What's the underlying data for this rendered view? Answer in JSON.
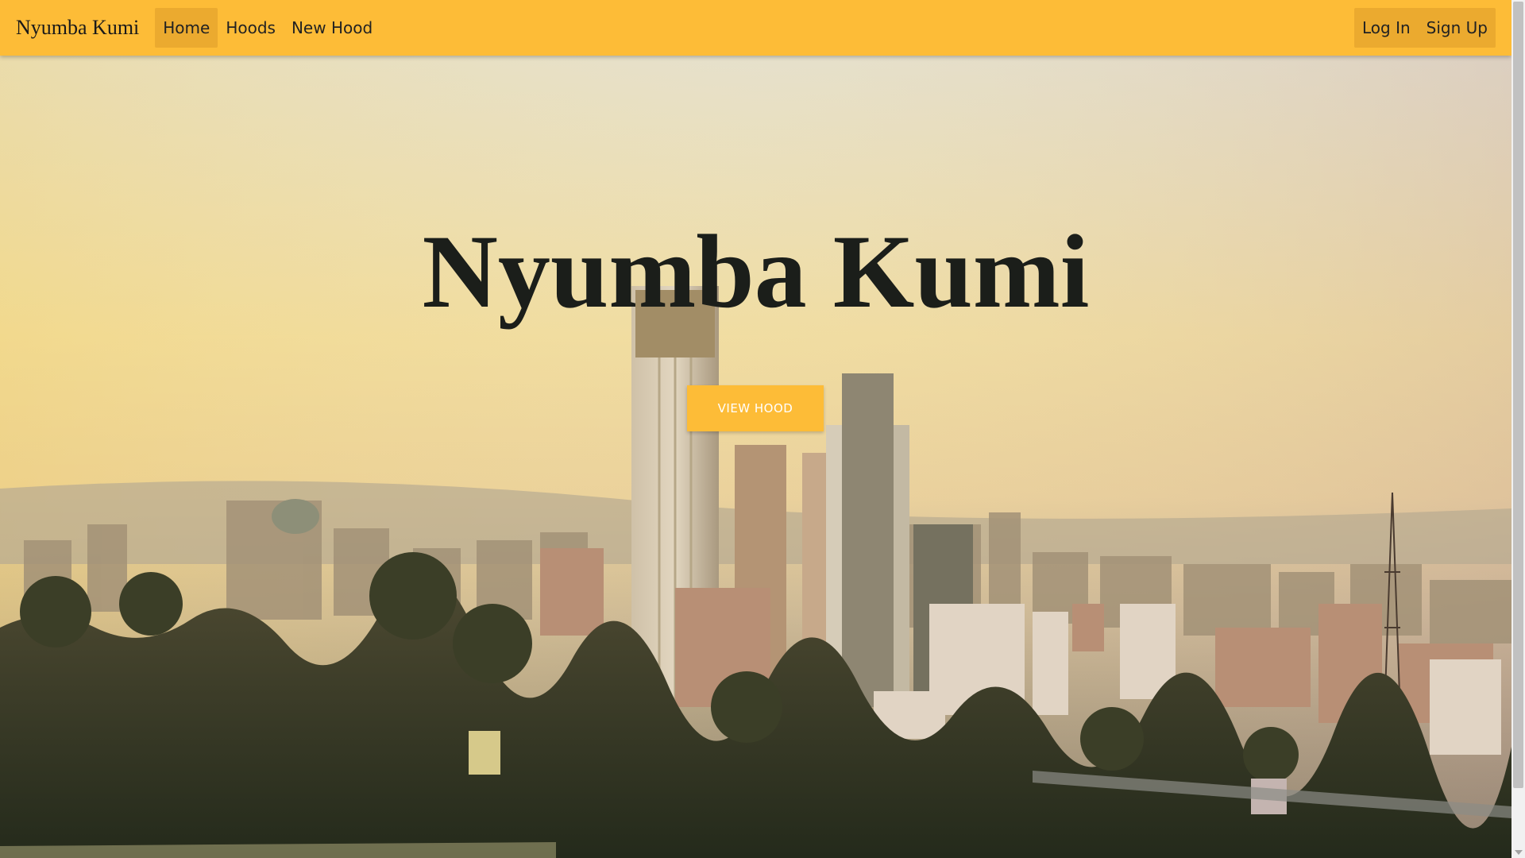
{
  "nav": {
    "brand": "Nyumba Kumi",
    "links": [
      {
        "label": "Home",
        "active": true
      },
      {
        "label": "Hoods",
        "active": false
      },
      {
        "label": "New Hood",
        "active": false
      }
    ],
    "auth": [
      {
        "label": "Log In"
      },
      {
        "label": "Sign Up"
      }
    ]
  },
  "hero": {
    "title": "Nyumba Kumi",
    "button_label": "VIEW HOOD",
    "background_image": "city-skyline-photo"
  },
  "colors": {
    "accent": "#fdbc37",
    "accent_dark": "#ebaa2f",
    "title": "#1b1e1a"
  }
}
